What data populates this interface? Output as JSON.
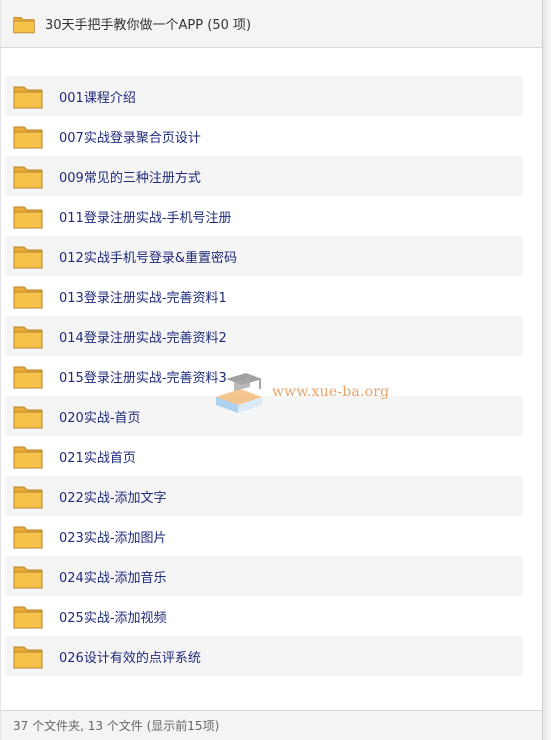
{
  "header": {
    "title": "30天手把手教你做一个APP (50 项)"
  },
  "items": [
    {
      "label": "001课程介绍"
    },
    {
      "label": "007实战登录聚合页设计"
    },
    {
      "label": "009常见的三种注册方式"
    },
    {
      "label": "011登录注册实战-手机号注册"
    },
    {
      "label": "012实战手机号登录&重置密码"
    },
    {
      "label": "013登录注册实战-完善资料1"
    },
    {
      "label": "014登录注册实战-完善资料2"
    },
    {
      "label": "015登录注册实战-完善资料3"
    },
    {
      "label": "020实战-首页"
    },
    {
      "label": "021实战首页"
    },
    {
      "label": "022实战-添加文字"
    },
    {
      "label": "023实战-添加图片"
    },
    {
      "label": "024实战-添加音乐"
    },
    {
      "label": "025实战-添加视频"
    },
    {
      "label": "026设计有效的点评系统"
    }
  ],
  "footer": {
    "summary": "37 个文件夹, 13 个文件 (显示前15项)"
  },
  "watermark": {
    "text": "www.xue-ba.org"
  },
  "colors": {
    "folder_fill": "#f7c24a",
    "folder_tab": "#e9a93a",
    "label_text": "#1f2a7a",
    "row_alt_bg": "#f5f5f5"
  }
}
